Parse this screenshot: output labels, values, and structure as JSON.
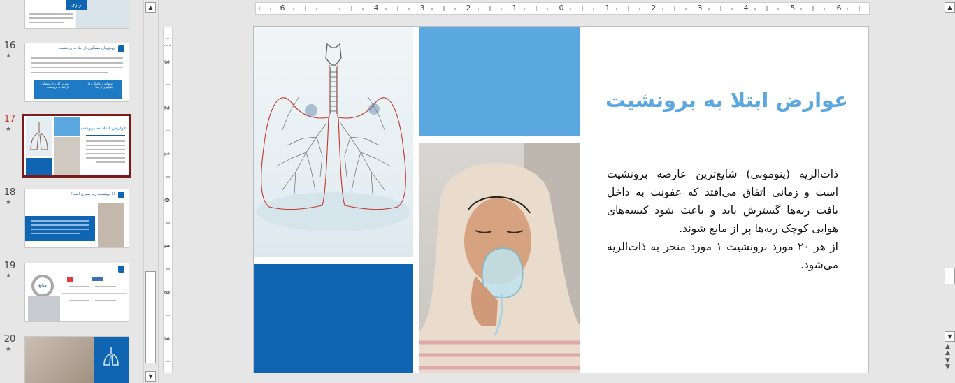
{
  "thumbnails": [
    {
      "number": "",
      "title": "رنوی"
    },
    {
      "number": "16",
      "title": "روش‌های پیشگیری از ابتلا به برونشیت"
    },
    {
      "number": "17",
      "title": "عوارض ابتلا به برونشیت"
    },
    {
      "number": "18",
      "title": "آیا برونشیت ریه مسری است؟"
    },
    {
      "number": "19",
      "title": "منابع"
    },
    {
      "number": "20",
      "title": ""
    }
  ],
  "thumb16_box1": "بهترین کار برای پیشگیری از ابتلا به برونشیت",
  "thumb16_box2": "استفاده از ماسک برای جلوگیری از ابتلا",
  "thumb19_circle": "منابع",
  "star": "★",
  "ruler_h": [
    "6",
    "4",
    "3",
    "2",
    "1",
    "0",
    "1",
    "2",
    "3",
    "4",
    "5",
    "6"
  ],
  "ruler_v": [
    "3",
    "2",
    "1",
    "0",
    "1",
    "2",
    "3"
  ],
  "slide": {
    "title": "عوارض ابتلا به برونشیت",
    "paragraph1": "ذات‌الریه (پنومونی) شایع‌ترین عارضه برونشیت است و زمانی اتفاق می‌افتد که عفونت به داخل بافت ریه‌ها گسترش یابد و باعث شود کیسه‌های هوایی کوچک ریه‌ها پر از مایع شوند.",
    "paragraph2": "از هر ۲۰ مورد برونشیت ۱ مورد منجر به ذات‌الریه می‌شود."
  },
  "colors": {
    "dark_blue": "#0f65b1",
    "light_blue": "#5aa8df",
    "selection": "#7a1a1a"
  }
}
